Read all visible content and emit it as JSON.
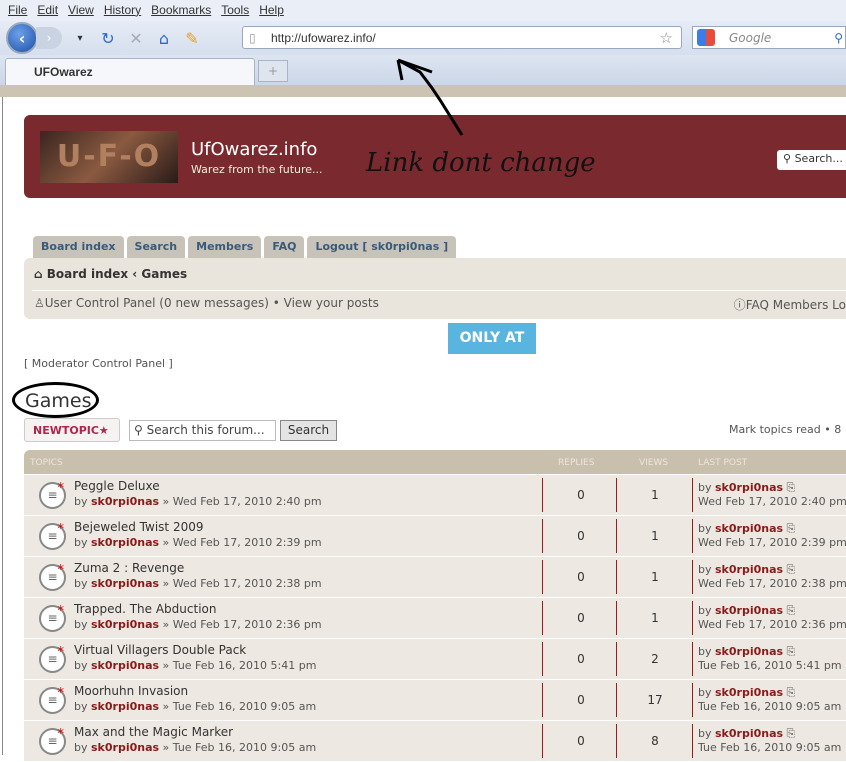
{
  "browser": {
    "menu": [
      "File",
      "Edit",
      "View",
      "History",
      "Bookmarks",
      "Tools",
      "Help"
    ],
    "url": "http://ufowarez.info/",
    "search_placeholder": "Google",
    "tab_title": "UFOwarez"
  },
  "header": {
    "logo_text": "U-F-O",
    "site_title": "UfOwarez.info",
    "site_desc": "Warez from the future...",
    "search_placeholder": "Search...",
    "annotation": "Link dont change"
  },
  "nav_tabs": [
    "Board index",
    "Search",
    "Members",
    "FAQ",
    "Logout [ sk0rpi0nas ]"
  ],
  "breadcrumb": "Board index ‹ Games",
  "user_bar": {
    "left": "User Control Panel (0 new messages) • View your posts",
    "right": "FAQ  Members  Lo"
  },
  "only_at": "ONLY AT",
  "moderator": "[ Moderator Control Panel ]",
  "forum_title": "Games",
  "new_topic": "NEWTOPIC★",
  "forum_search": {
    "placeholder": "Search this forum...",
    "button": "Search"
  },
  "mark_read": "Mark topics read • 8",
  "table": {
    "headers": [
      "TOPICS",
      "REPLIES",
      "VIEWS",
      "LAST POST"
    ],
    "rows": [
      {
        "title": "Peggle Deluxe",
        "author": "sk0rpi0nas",
        "date": "» Wed Feb 17, 2010 2:40 pm",
        "replies": "0",
        "views": "1",
        "last_by": "sk0rpi0nas",
        "last_date": "Wed Feb 17, 2010 2:40 pm"
      },
      {
        "title": "Bejeweled Twist 2009",
        "author": "sk0rpi0nas",
        "date": "» Wed Feb 17, 2010 2:39 pm",
        "replies": "0",
        "views": "1",
        "last_by": "sk0rpi0nas",
        "last_date": "Wed Feb 17, 2010 2:39 pm"
      },
      {
        "title": "Zuma 2 : Revenge",
        "author": "sk0rpi0nas",
        "date": "» Wed Feb 17, 2010 2:38 pm",
        "replies": "0",
        "views": "1",
        "last_by": "sk0rpi0nas",
        "last_date": "Wed Feb 17, 2010 2:38 pm"
      },
      {
        "title": "Trapped. The Abduction",
        "author": "sk0rpi0nas",
        "date": "» Wed Feb 17, 2010 2:36 pm",
        "replies": "0",
        "views": "1",
        "last_by": "sk0rpi0nas",
        "last_date": "Wed Feb 17, 2010 2:36 pm"
      },
      {
        "title": "Virtual Villagers Double Pack",
        "author": "sk0rpi0nas",
        "date": "» Tue Feb 16, 2010 5:41 pm",
        "replies": "0",
        "views": "2",
        "last_by": "sk0rpi0nas",
        "last_date": "Tue Feb 16, 2010 5:41 pm"
      },
      {
        "title": "Moorhuhn Invasion",
        "author": "sk0rpi0nas",
        "date": "» Tue Feb 16, 2010 9:05 am",
        "replies": "0",
        "views": "17",
        "last_by": "sk0rpi0nas",
        "last_date": "Tue Feb 16, 2010 9:05 am"
      },
      {
        "title": "Max and the Magic Marker",
        "author": "sk0rpi0nas",
        "date": "» Tue Feb 16, 2010 9:05 am",
        "replies": "0",
        "views": "8",
        "last_by": "sk0rpi0nas",
        "last_date": "Tue Feb 16, 2010 9:05 am"
      }
    ]
  }
}
